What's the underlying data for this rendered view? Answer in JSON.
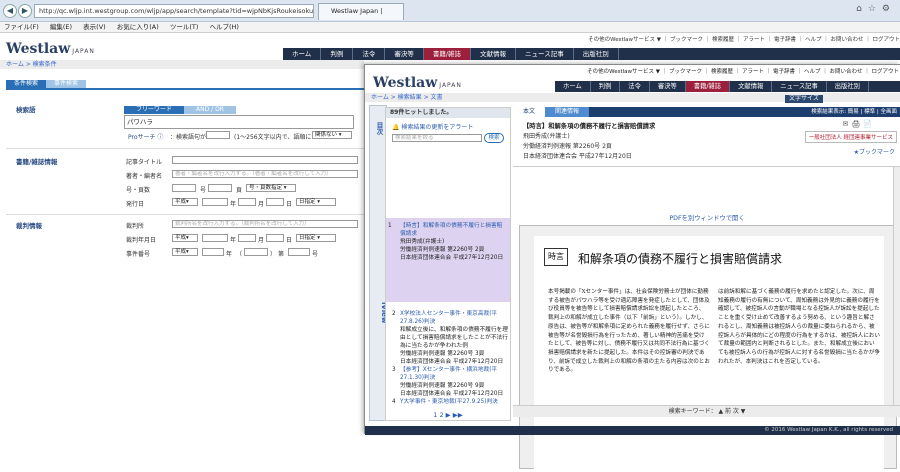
{
  "browser": {
    "url": "http://qc.wljp.int.westgroup.com/wljp/app/search/template?tid=wjpNbKjsRoukeisokuSe",
    "tab_title": "Westlaw Japan |",
    "menu": [
      "ファイル(F)",
      "編集(E)",
      "表示(V)",
      "お気に入り(A)",
      "ツール(T)",
      "ヘルプ(H)"
    ]
  },
  "brand": {
    "name": "Westlaw",
    "suffix": "JAPAN"
  },
  "nav": [
    "ホーム",
    "判例",
    "法令",
    "審決等",
    "書籍/雑誌",
    "文献情報",
    "ニュース記事",
    "出版社別"
  ],
  "util_links": "その他のWestlawサービス ▼ ｜ ブックマーク ｜ 検索履歴 ｜ アラート ｜ 電子辞書 ｜ ヘルプ ｜ お問い合わせ ｜ ログアウト",
  "search_page": {
    "breadcrumb": "ホーム > 検索条件",
    "tabs": [
      "条件検索",
      "事件検索"
    ],
    "keyword_section": "検索語",
    "keyword_tabs": [
      "フリーワード",
      "AND / OR"
    ],
    "keyword_value": "パワハラ",
    "pro_search": "Proサーチ ⓘ",
    "length_label": "：検索語句が",
    "length_hint": "(1〜256文字以内で、語順に",
    "length_select": "関係ない",
    "book_section": "書籍/雑誌情報",
    "book_rows": [
      "記事タイトル",
      "著者・編者名",
      "号・頁数",
      "発行日"
    ],
    "author_placeholder": "著者・編者名を改行入力する。（著者・編者名を改行して入力）",
    "page_unit": "号",
    "page_unit2": "頁",
    "page_select": "号・頁数指定",
    "era": "平成",
    "year": "年",
    "month": "月",
    "day": "日",
    "date_select": "日指定",
    "case_section": "裁判情報",
    "case_rows": [
      "裁判所",
      "裁判年月日",
      "事件番号"
    ],
    "court_placeholder": "裁判所名を改行入力する。（裁判所名を改行して入力）",
    "case_no_paren": "（",
    "case_no_paren2": "）",
    "case_no_unit": "第",
    "case_no_go": "号"
  },
  "doc_window": {
    "breadcrumb": "ホーム > 検索結果 > 文書",
    "font_size": "文字サイズ",
    "result_count": "89件ヒットしました。",
    "side_tab": "目次",
    "iview": "iView",
    "alert_link": "検索結果の更新をアラート",
    "search_in_results": "検索結果を絞る",
    "search_btn": "検索",
    "results": [
      {
        "no": "1",
        "title": "【時言】和解条項の債務不履行と損害賠償請求",
        "author": "飛田秀成(弁護士)",
        "src": "労働経済判例速報 第2260号  2頁",
        "pub": "日本経済団体連合会  平成27年12月20日"
      },
      {
        "no": "2",
        "title": "X学校法人センター事件・東京高裁(平27.8.26)判決",
        "author": "和解成立後に、和解条項の債務不履行を理由として損害賠償請求をしたことが不法行為に当たるかが争われた例",
        "src": "労働経済判例速報 第2260号  3頁",
        "pub": "日本経済団体連合会  平成27年12月20日"
      },
      {
        "no": "3",
        "title": "【参考】Xセンター事件・横浜地裁(平27.1.30)判決",
        "author": "",
        "src": "労働経済判例速報 第2260号  9頁",
        "pub": "日本経済団体連合会  平成27年12月20日"
      },
      {
        "no": "4",
        "title": "Y大学事件・東京地裁(平27.9.25)判決",
        "author": "大学の准教授、教授に対するパワハラを",
        "src": "",
        "pub": ""
      }
    ],
    "pages": "1 2 ▶ ▶▶",
    "doc_tabs": [
      "本文",
      "関連情報"
    ],
    "doc_title": "【時言】和解条項の債務不履行と損害賠償請求",
    "doc_author": "飛田秀成(弁護士)",
    "doc_src": "労働経済判例速報 第2260号  2頁",
    "doc_pub": "日本経済団体連合会  平成27年12月20日",
    "doc_actions": "検索結果表示: 簡易 | 標準 | 全画面",
    "bookmark": "ブックマーク",
    "service_badge": "ー般社団法人 経団連事業サービス",
    "pdf_link": "PDFを別ウィンドウで開く",
    "paper_badge": "時言",
    "paper_title": "和解条項の債務不履行と損害賠償請求",
    "col1": "本号掲載の「Xセンター事件」は、社会保険労務士が団体に勤務する被告がパワハラ等を受け適応障害を発症したとして、団体及び役員等を被告等として損害賠償請求訴訟を提起したところ、裁判上の和解が成立した事件（以下「前訴」という）。しかし、原告は、被告等が和解条項に定められた義務を履行せず、さらに被告等が名誉毀損行為を行ったため、著しい精神的苦痛を受けたとして、被告等に対し、債務不履行又は共同不法行為に基づく損害賠償請求を新たに提起した。本件はその控訴審の判決であり、前訴で成立した裁判上の和解の条項の主たる内容は次のとおりである。",
    "col2": "は前訴和解に基づく義務の履行を求めたと認定した。次に、周知義務の履行の有無について、周知義務は外見的に義務の履行を確認して、被控訴人の言動が職場となる控訴人が訴訟を提起したことを重く受け止めて改善するよう努める、という趣旨と解されるとし、周知義務は被控訴人らの裁量に委ねられるから、被控訴人らが具体的にどの程度の行為をするかは、被控訴人において裁量の範囲内と判断されるとした。また、和解成立後においても被控訴人らの行為が控訴人に対する名誉毀損に当たるかが争われたが、本判決はこれを否定している。",
    "keyword_bar": "検索キーワード：  ▲ 前    次 ▼",
    "footer": "© 2016 Westlaw Japan K.K., all rights reserved"
  }
}
